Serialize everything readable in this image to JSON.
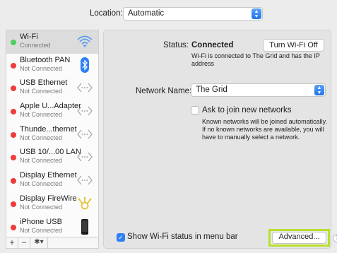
{
  "location": {
    "label": "Location:",
    "value": "Automatic"
  },
  "services": [
    {
      "name": "Wi-Fi",
      "status": "Connected",
      "dot": "green",
      "icon": "wifi-icon",
      "selected": true
    },
    {
      "name": "Bluetooth PAN",
      "status": "Not Connected",
      "dot": "red",
      "icon": "bluetooth-icon"
    },
    {
      "name": "USB Ethernet",
      "status": "Not Connected",
      "dot": "red",
      "icon": "ethernet-icon"
    },
    {
      "name": "Apple U...Adapter",
      "status": "Not Connected",
      "dot": "red",
      "icon": "ethernet-icon"
    },
    {
      "name": "Thunde...thernet",
      "status": "Not Connected",
      "dot": "red",
      "icon": "ethernet-icon"
    },
    {
      "name": "USB 10/...00 LAN",
      "status": "Not Connected",
      "dot": "red",
      "icon": "ethernet-icon"
    },
    {
      "name": "Display Ethernet",
      "status": "Not Connected",
      "dot": "red",
      "icon": "ethernet-icon"
    },
    {
      "name": "Display FireWire",
      "status": "Not Connected",
      "dot": "red",
      "icon": "firewire-icon"
    },
    {
      "name": "iPhone USB",
      "status": "Not Connected",
      "dot": "red",
      "icon": "iphone-icon"
    }
  ],
  "sidebar_controls": {
    "add": "+",
    "remove": "−",
    "gear": "✱▾"
  },
  "detail": {
    "status_label": "Status:",
    "status_value": "Connected",
    "turn_off_button": "Turn Wi-Fi Off",
    "status_description": "Wi-Fi is connected to The Grid and has the IP address",
    "network_name_label": "Network Name:",
    "network_name_value": "The Grid",
    "ask_to_join_label": "Ask to join new networks",
    "ask_to_join_checked": false,
    "ask_to_join_description": "Known networks will be joined automatically. If no known networks are available, you will have to manually select a network.",
    "show_status_label": "Show Wi-Fi status in menu bar",
    "show_status_checked": true,
    "advanced_button": "Advanced...",
    "help": "?"
  },
  "colors": {
    "accent": "#2f7ff5",
    "connected": "#4cd15b",
    "disconnected": "#ef3b3b",
    "highlight": "#b6e02e"
  }
}
